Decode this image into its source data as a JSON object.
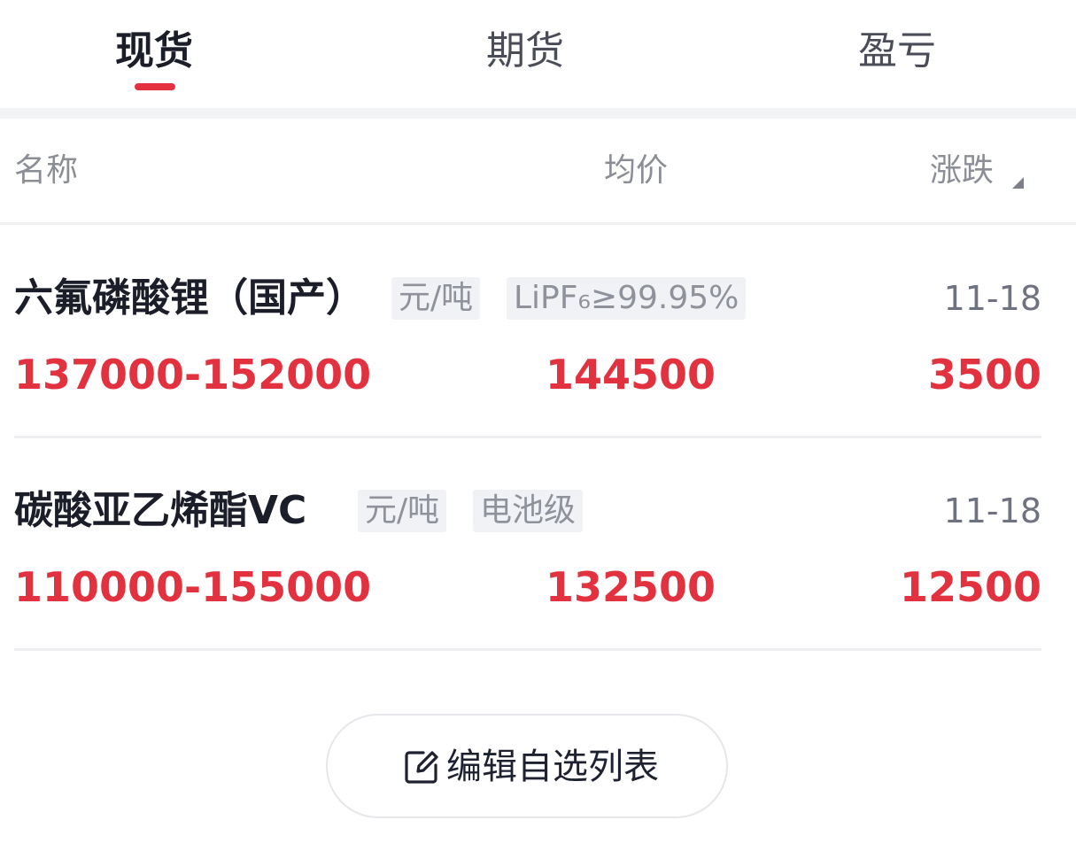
{
  "tabs": [
    {
      "label": "现货",
      "active": true
    },
    {
      "label": "期货",
      "active": false
    },
    {
      "label": "盈亏",
      "active": false
    }
  ],
  "columns": {
    "name": "名称",
    "avg": "均价",
    "change": "涨跌"
  },
  "rows": [
    {
      "name": "六氟磷酸锂（国产）",
      "unit": "元/吨",
      "spec": "LiPF₆≥99.95%",
      "date": "11-18",
      "range": "137000-152000",
      "avg": "144500",
      "change": "3500"
    },
    {
      "name": "碳酸亚乙烯酯VC",
      "unit": "元/吨",
      "spec": "电池级",
      "date": "11-18",
      "range": "110000-155000",
      "avg": "132500",
      "change": "12500"
    }
  ],
  "edit_button": {
    "label": "编辑自选列表",
    "icon": "edit-icon"
  },
  "colors": {
    "accent": "#e5303f",
    "price": "#e2323f",
    "muted": "#8b8e97",
    "tag_bg": "#f1f2f6"
  }
}
